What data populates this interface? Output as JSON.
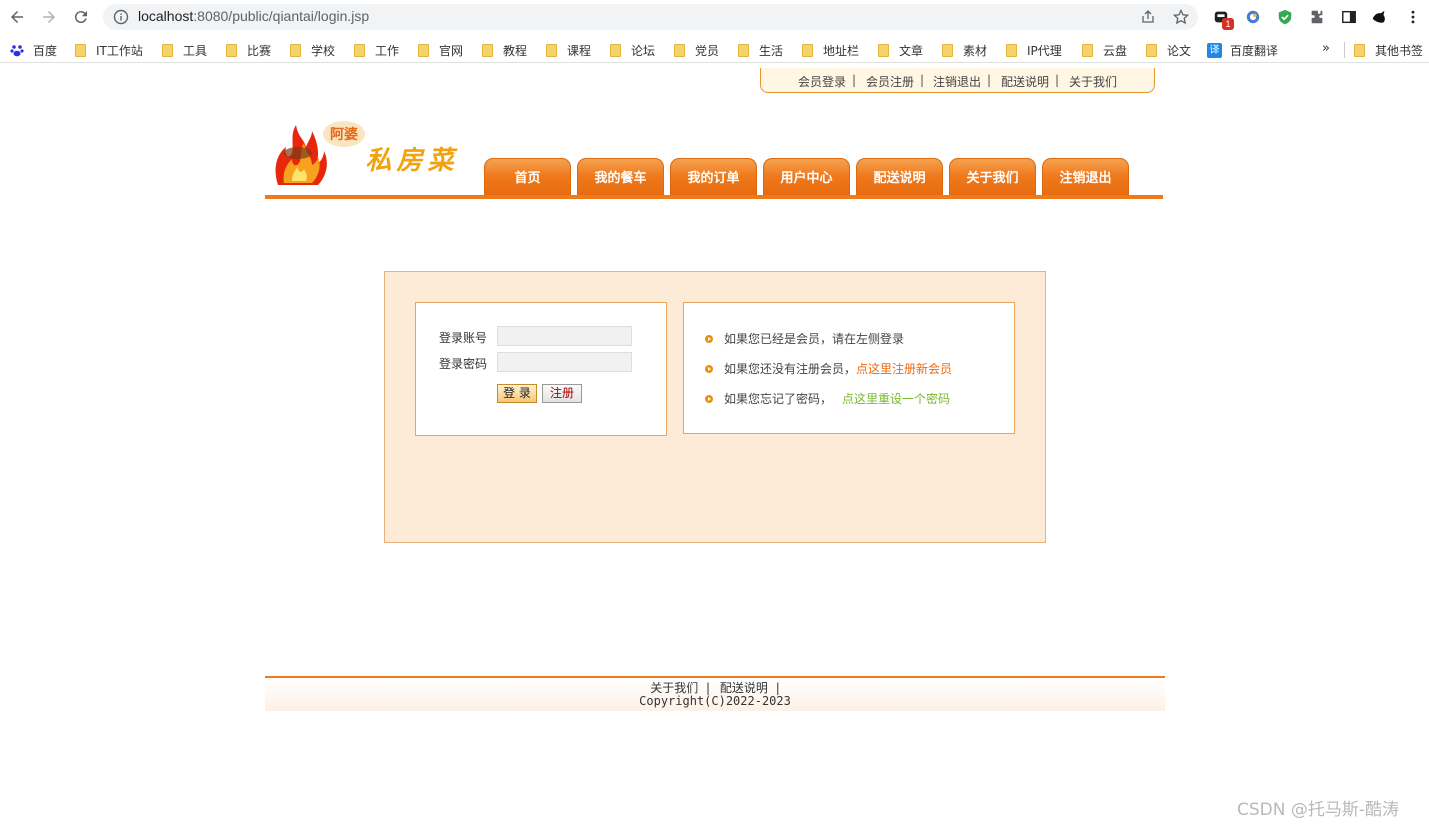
{
  "browser": {
    "url_host": "localhost",
    "url_rest": ":8080/public/qiantai/login.jsp",
    "extension_badge": "1",
    "bookmarks": [
      "百度",
      "IT工作站",
      "工具",
      "比赛",
      "学校",
      "工作",
      "官网",
      "教程",
      "课程",
      "论坛",
      "党员",
      "生活",
      "地址栏",
      "文章",
      "素材",
      "IP代理",
      "云盘",
      "论文",
      "百度翻译"
    ],
    "bookmarks_more": "»",
    "other_bookmarks": "其他书签",
    "translate_icon_text": "译"
  },
  "top_links": [
    "会员登录",
    "会员注册",
    "注销退出",
    "配送说明",
    "关于我们"
  ],
  "top_links_separator": "|",
  "logo": {
    "badge": "阿婆",
    "title": "私房菜"
  },
  "nav_tabs": [
    "首页",
    "我的餐车",
    "我的订单",
    "用户中心",
    "配送说明",
    "关于我们",
    "注销退出"
  ],
  "login": {
    "account_label": "登录账号",
    "password_label": "登录密码",
    "account_value": "",
    "password_value": "",
    "login_button": "登 录",
    "register_button": "注册"
  },
  "info": {
    "line1": "如果您已经是会员，请在左侧登录",
    "line2_text": "如果您还没有注册会员，",
    "line2_link": "点这里注册新会员",
    "line3_text": "如果您忘记了密码，",
    "line3_link": "点这里重设一个密码"
  },
  "footer": {
    "link1": "关于我们",
    "link2": "配送说明",
    "separator": "|",
    "copyright": "Copyright(C)2022-2023"
  },
  "watermark": "CSDN @托马斯-酷涛",
  "colors": {
    "accent": "#ef7a1d",
    "panel_bg": "#fdebd8",
    "link_orange": "#ee6a0f",
    "link_green": "#7ab92f"
  }
}
